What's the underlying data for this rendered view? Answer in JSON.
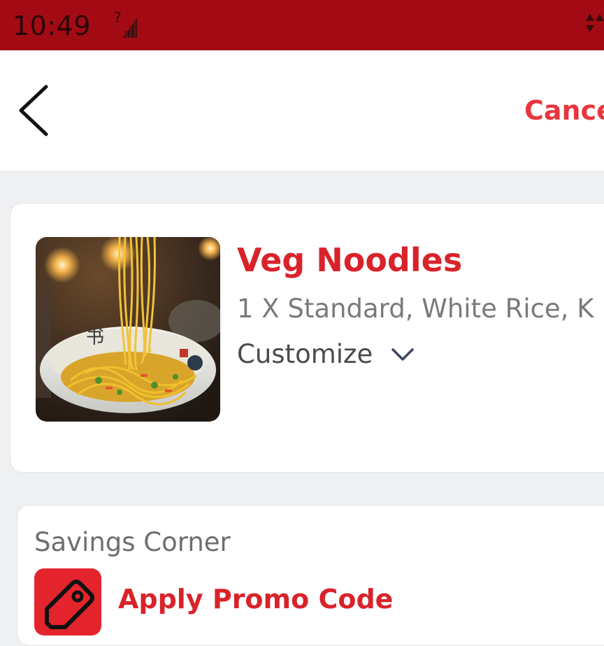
{
  "status_bar": {
    "time": "10:49",
    "background": "#a30b14",
    "icons": [
      "signal-no-sim-icon",
      "data-arrows-icon"
    ]
  },
  "header": {
    "back_icon": "chevron-left-icon",
    "cancel_label": "Cance"
  },
  "item": {
    "image_name": "veg-noodles-photo",
    "title": "Veg Noodles",
    "description": "1 X Standard, White Rice, K",
    "customize_label": "Customize",
    "customize_icon": "chevron-down-icon"
  },
  "savings": {
    "title": "Savings Corner",
    "promo_label": "Apply Promo Code",
    "promo_icon": "tag-icon"
  },
  "colors": {
    "brand_red": "#e8363d",
    "title_red": "#d9232b",
    "page_background": "#eef0f2"
  }
}
